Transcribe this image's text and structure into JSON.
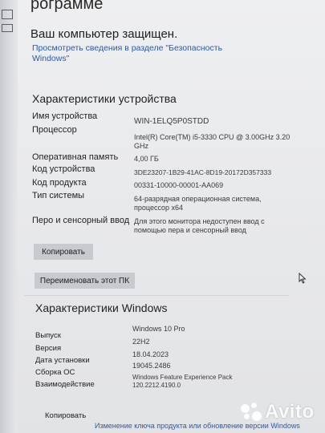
{
  "header": {
    "partial_heading": "рограмме",
    "protected_text": "Ваш компьютер защищен.",
    "security_link": "Просмотреть сведения в разделе \"Безопасность Windows\""
  },
  "device_specs": {
    "title": "Характеристики устройства",
    "rows": [
      {
        "label": "Имя устройства",
        "value": "WIN-1ELQ5P0STDD"
      },
      {
        "label": "Процессор",
        "value": "Intel(R) Core(TM) i5-3330 CPU @ 3.00GHz 3.20 GHz"
      },
      {
        "label": "Оперативная память",
        "value": "4,00 ГБ"
      },
      {
        "label": "Код устройства",
        "value": "3DE23207-1B29-41AC-8D19-20172D357333"
      },
      {
        "label": "Код продукта",
        "value": "00331-10000-00001-AA069"
      },
      {
        "label": "Тип системы",
        "value": "64-разрядная операционная система, процессор x64"
      },
      {
        "label": "Перо и сенсорный ввод",
        "value": "Для этого монитора недоступен ввод с помощью пера и сенсорный ввод"
      }
    ],
    "copy_button": "Копировать",
    "rename_button": "Переименовать этот ПК"
  },
  "windows_specs": {
    "title": "Характеристики Windows",
    "rows": [
      {
        "label": "Выпуск",
        "value": "Windows 10 Pro"
      },
      {
        "label": "Версия",
        "value": "22H2"
      },
      {
        "label": "Дата установки",
        "value": "18.04.2023"
      },
      {
        "label": "Сборка ОС",
        "value": "19045.2486"
      },
      {
        "label": "Взаимодействие",
        "value": "Windows Feature Experience Pack 120.2212.4190.0"
      }
    ],
    "copy_button": "Копировать",
    "update_link": "Изменение ключа продукта или обновление версии Windows"
  },
  "watermark": {
    "text": "Avito"
  },
  "colors": {
    "link": "#2a5aa8",
    "button": "#c8cad0",
    "background": "#e9eaed"
  }
}
